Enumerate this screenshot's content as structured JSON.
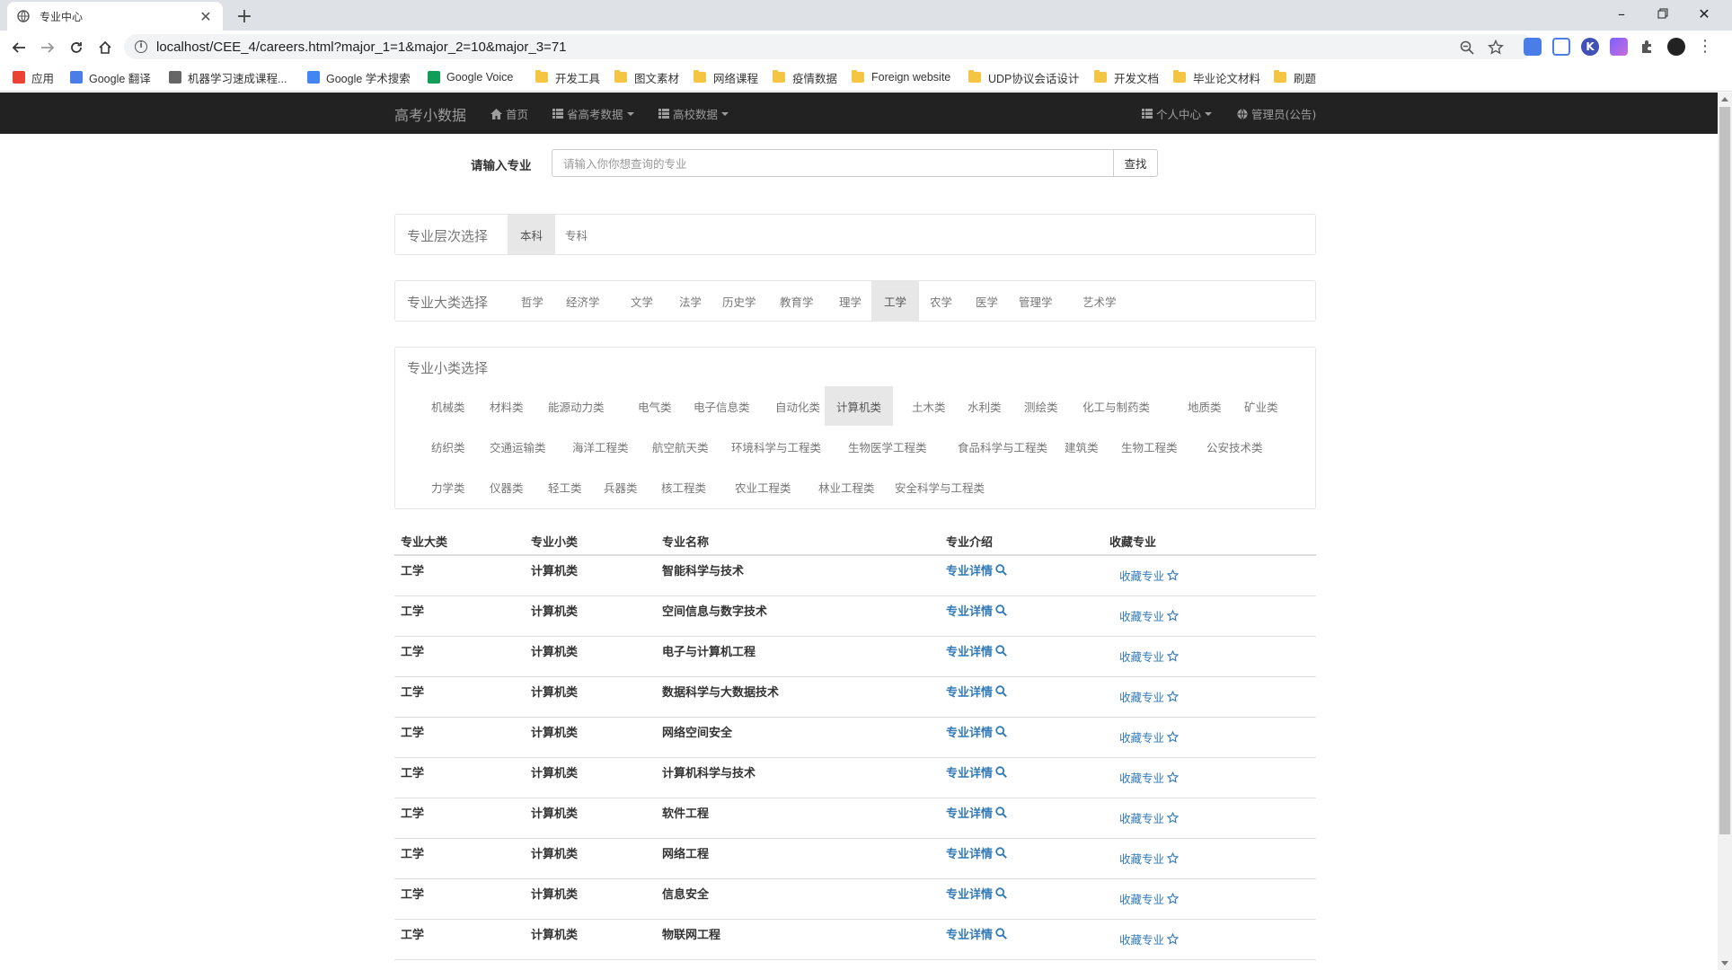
{
  "browser": {
    "tab_title": "专业中心",
    "url": "localhost/CEE_4/careers.html?major_1=1&major_2=10&major_3=71",
    "bookmarks": [
      {
        "label": "应用",
        "icon": "apps-grid-icon"
      },
      {
        "label": "Google 翻译",
        "icon": "google-translate-icon"
      },
      {
        "label": "机器学习速成课程...",
        "icon": "code-icon"
      },
      {
        "label": "Google 学术搜索",
        "icon": "google-scholar-icon"
      },
      {
        "label": "Google Voice",
        "icon": "google-voice-icon"
      },
      {
        "label": "开发工具",
        "icon": "folder-icon"
      },
      {
        "label": "图文素材",
        "icon": "folder-icon"
      },
      {
        "label": "网络课程",
        "icon": "folder-icon"
      },
      {
        "label": "疫情数据",
        "icon": "folder-icon"
      },
      {
        "label": "Foreign website",
        "icon": "folder-icon"
      },
      {
        "label": "UDP协议会话设计",
        "icon": "folder-icon"
      },
      {
        "label": "开发文档",
        "icon": "folder-icon"
      },
      {
        "label": "毕业论文材料",
        "icon": "folder-icon"
      },
      {
        "label": "刷题",
        "icon": "folder-icon"
      }
    ]
  },
  "navbar": {
    "brand": "高考小数据",
    "home": "首页",
    "province_data": "省高考数据",
    "college_data": "高校数据",
    "personal_center": "个人中心",
    "admin": "管理员(公告)"
  },
  "search": {
    "label": "请输入专业",
    "placeholder": "请输入你你想查询的专业",
    "button": "查找"
  },
  "level_filter": {
    "title": "专业层次选择",
    "options": [
      "本科",
      "专科"
    ],
    "selected": "本科"
  },
  "category_filter": {
    "title": "专业大类选择",
    "options": [
      "哲学",
      "经济学",
      "文学",
      "法学",
      "历史学",
      "教育学",
      "理学",
      "工学",
      "农学",
      "医学",
      "管理学",
      "艺术学"
    ],
    "selected": "工学"
  },
  "subcategory_filter": {
    "title": "专业小类选择",
    "rows": [
      [
        "机械类",
        "材料类",
        "能源动力类",
        "电气类",
        "电子信息类",
        "自动化类",
        "计算机类",
        "土木类",
        "水利类",
        "测绘类",
        "化工与制药类",
        "地质类",
        "矿业类"
      ],
      [
        "纺织类",
        "交通运输类",
        "海洋工程类",
        "航空航天类",
        "环境科学与工程类",
        "生物医学工程类",
        "食品科学与工程类",
        "建筑类",
        "生物工程类",
        "公安技术类"
      ],
      [
        "力学类",
        "仪器类",
        "轻工类",
        "兵器类",
        "核工程类",
        "农业工程类",
        "林业工程类",
        "安全科学与工程类"
      ]
    ],
    "selected": "计算机类"
  },
  "table": {
    "headers": [
      "专业大类",
      "专业小类",
      "专业名称",
      "专业介绍",
      "收藏专业"
    ],
    "detail_link": "专业详情",
    "favorite_link": "收藏专业",
    "rows": [
      {
        "category": "工学",
        "subcategory": "计算机类",
        "name": "智能科学与技术"
      },
      {
        "category": "工学",
        "subcategory": "计算机类",
        "name": "空间信息与数字技术"
      },
      {
        "category": "工学",
        "subcategory": "计算机类",
        "name": "电子与计算机工程"
      },
      {
        "category": "工学",
        "subcategory": "计算机类",
        "name": "数据科学与大数据技术"
      },
      {
        "category": "工学",
        "subcategory": "计算机类",
        "name": "网络空间安全"
      },
      {
        "category": "工学",
        "subcategory": "计算机类",
        "name": "计算机科学与技术"
      },
      {
        "category": "工学",
        "subcategory": "计算机类",
        "name": "软件工程"
      },
      {
        "category": "工学",
        "subcategory": "计算机类",
        "name": "网络工程"
      },
      {
        "category": "工学",
        "subcategory": "计算机类",
        "name": "信息安全"
      },
      {
        "category": "工学",
        "subcategory": "计算机类",
        "name": "物联网工程"
      }
    ]
  },
  "colors": {
    "navbar_bg": "#222222",
    "link": "#337ab7",
    "active_pill": "#e7e7e7"
  }
}
